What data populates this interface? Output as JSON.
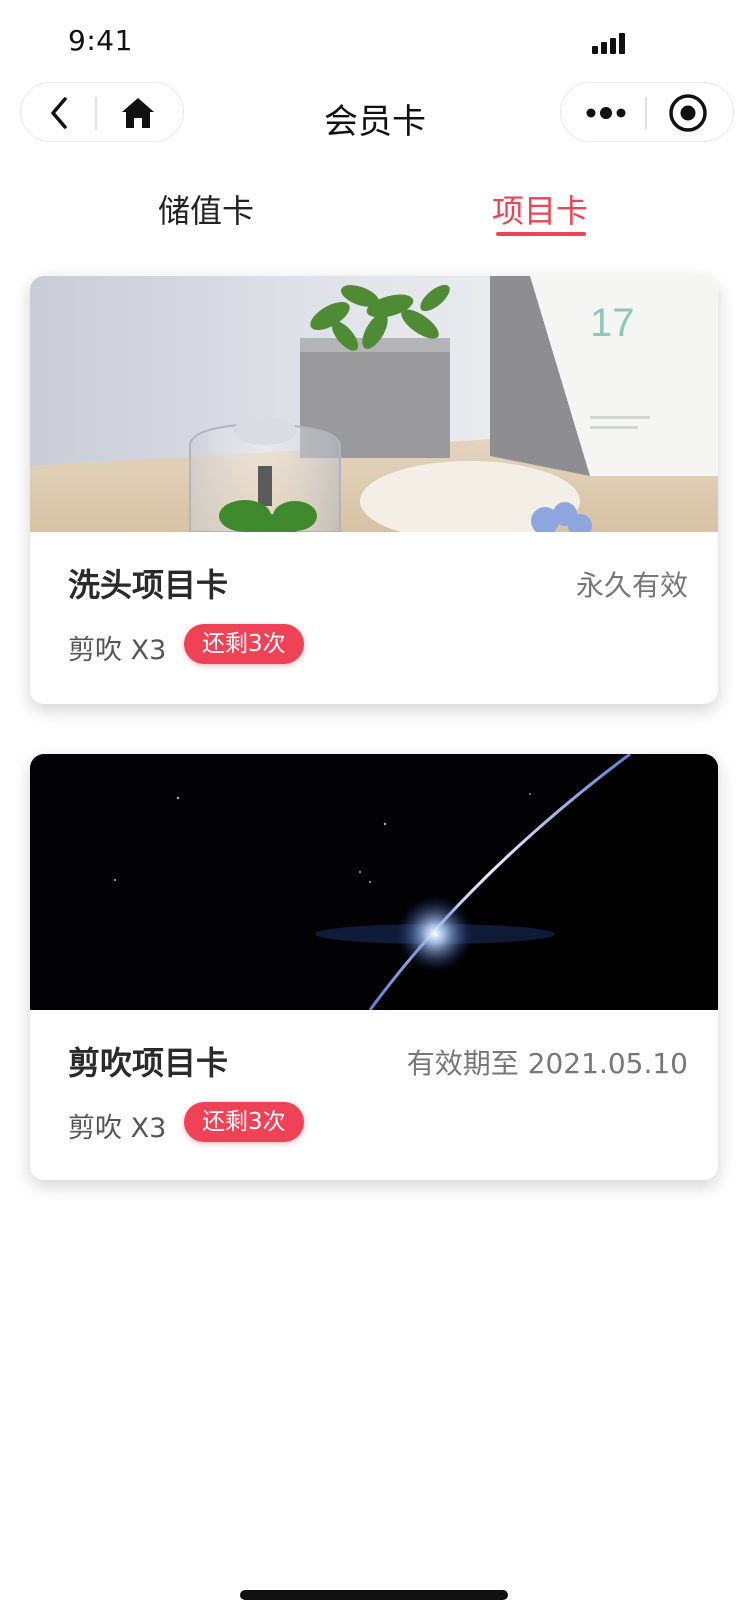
{
  "status_bar": {
    "time": "9:41"
  },
  "nav": {
    "title": "会员卡"
  },
  "tabs": [
    {
      "label": "储值卡",
      "active": false
    },
    {
      "label": "项目卡",
      "active": true
    }
  ],
  "colors": {
    "accent": "#ef4256"
  },
  "cards": [
    {
      "image": "desk-plant-calendar-photo",
      "title": "洗头项目卡",
      "validity": "永久有效",
      "service": "剪吹 X3",
      "remaining": "还剩3次",
      "calendar_day": "17"
    },
    {
      "image": "earth-horizon-space-photo",
      "title": "剪吹项目卡",
      "validity": "有效期至 2021.05.10",
      "service": "剪吹 X3",
      "remaining": "还剩3次"
    }
  ]
}
